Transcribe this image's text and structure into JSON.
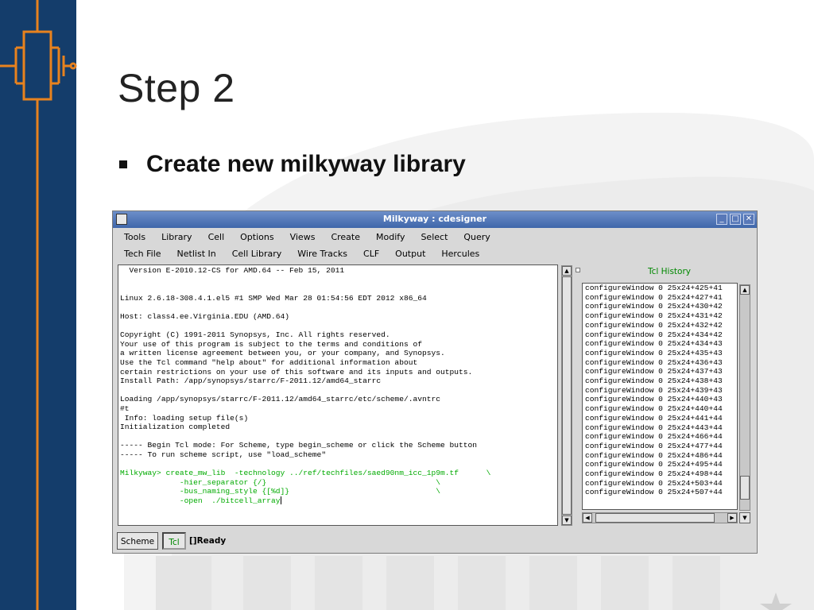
{
  "slide": {
    "title": "Step 2",
    "bullet": "Create new milkyway library"
  },
  "window": {
    "title": "Milkyway : cdesigner",
    "menu_row1": [
      "Tools",
      "Library",
      "Cell",
      "Options",
      "Views",
      "Create",
      "Modify",
      "Select",
      "Query"
    ],
    "menu_row2": [
      "Tech File",
      "Netlist In",
      "Cell Library",
      "Wire Tracks",
      "CLF",
      "Output",
      "Hercules"
    ]
  },
  "console": {
    "output_lines": [
      "  Version E-2010.12-CS for AMD.64 -- Feb 15, 2011",
      "",
      "",
      "Linux 2.6.18-308.4.1.el5 #1 SMP Wed Mar 28 01:54:56 EDT 2012 x86_64",
      "",
      "Host: class4.ee.Virginia.EDU (AMD.64)",
      "",
      "Copyright (C) 1991-2011 Synopsys, Inc. All rights reserved.",
      "Your use of this program is subject to the terms and conditions of",
      "a written license agreement between you, or your company, and Synopsys.",
      "Use the Tcl command \"help about\" for additional information about",
      "certain restrictions on your use of this software and its inputs and outputs.",
      "Install Path: /app/synopsys/starrc/F-2011.12/amd64_starrc",
      "",
      "Loading /app/synopsys/starrc/F-2011.12/amd64_starrc/etc/scheme/.avntrc",
      "#t",
      " Info: loading setup file(s)",
      "Initialization completed",
      "",
      "----- Begin Tcl mode: For Scheme, type begin_scheme or click the Scheme button",
      "----- To run scheme script, use \"load_scheme\"",
      ""
    ],
    "command_lines": [
      "Milkyway> create_mw_lib  -technology ../ref/techfiles/saed90nm_icc_1p9m.tf      \\",
      "             -hier_separator {/}                                     \\",
      "             -bus_naming_style {[%d]}                                \\",
      "             -open  ./bitcell_array"
    ]
  },
  "history": {
    "header": "Tcl History",
    "items": [
      "configureWindow 0 25x24+425+41",
      "configureWindow 0 25x24+427+41",
      "configureWindow 0 25x24+430+42",
      "configureWindow 0 25x24+431+42",
      "configureWindow 0 25x24+432+42",
      "configureWindow 0 25x24+434+42",
      "configureWindow 0 25x24+434+43",
      "configureWindow 0 25x24+435+43",
      "configureWindow 0 25x24+436+43",
      "configureWindow 0 25x24+437+43",
      "configureWindow 0 25x24+438+43",
      "configureWindow 0 25x24+439+43",
      "configureWindow 0 25x24+440+43",
      "configureWindow 0 25x24+440+44",
      "configureWindow 0 25x24+441+44",
      "configureWindow 0 25x24+443+44",
      "configureWindow 0 25x24+466+44",
      "configureWindow 0 25x24+477+44",
      "configureWindow 0 25x24+486+44",
      "configureWindow 0 25x24+495+44",
      "configureWindow 0 25x24+498+44",
      "configureWindow 0 25x24+503+44",
      "configureWindow 0 25x24+507+44"
    ]
  },
  "status": {
    "scheme_label": "Scheme",
    "tcl_label": "Tcl",
    "ready_text": "[]Ready"
  },
  "icons": {
    "minimize": "minimize-icon",
    "maximize": "maximize-icon",
    "close": "close-icon",
    "scroll_up": "arrow-up-icon",
    "scroll_down": "arrow-down-icon",
    "scroll_left": "arrow-left-icon",
    "scroll_right": "arrow-right-icon"
  },
  "colors": {
    "sidebar": "#143d6b",
    "accent": "#e8821e",
    "titlebar": "#4f74b8",
    "command_text": "#00aa00"
  }
}
